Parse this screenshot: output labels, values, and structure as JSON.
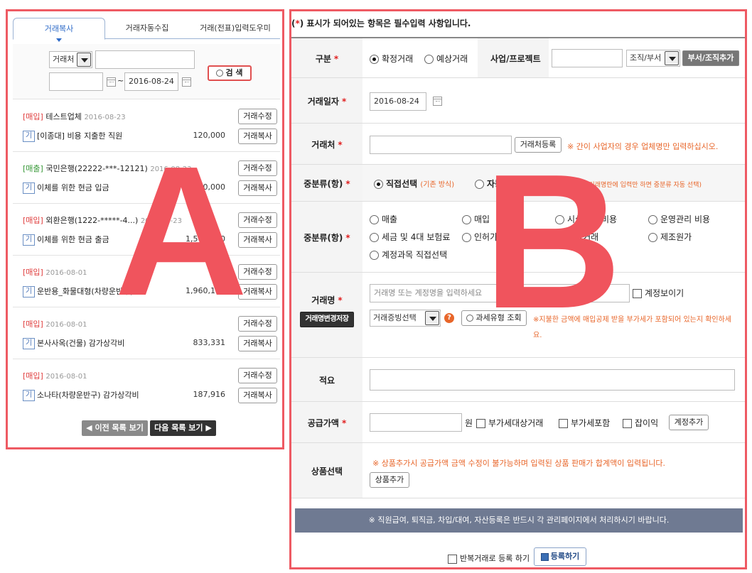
{
  "tabs": [
    {
      "label": "거래복사",
      "active": true
    },
    {
      "label": "거래자동수집",
      "active": false
    },
    {
      "label": "거래(전표)입력도우미",
      "active": false
    }
  ],
  "search": {
    "field_select": "거래처",
    "keyword": "",
    "date_from": "",
    "date_to": "2016-08-24",
    "date_sep": "~",
    "button": "검 색"
  },
  "list": {
    "items": [
      {
        "tag": "[매입]",
        "tag_type": "buy",
        "name": "테스트업체",
        "date": "2016-08-23",
        "ga": "기",
        "desc": "[이종대] 비용 지출한 직원",
        "amount": "120,000"
      },
      {
        "tag": "[매출]",
        "tag_type": "sell",
        "name": "국민은행(22222-***-12121)",
        "date": "2016-08-23",
        "ga": "기",
        "desc": "이체를 위한 현금 입금",
        "amount": "1,500,000"
      },
      {
        "tag": "[매입]",
        "tag_type": "buy",
        "name": "외환은행(1222-*****-4...)",
        "date": "2016-08-23",
        "ga": "기",
        "desc": "이체를 위한 현금 출금",
        "amount": "1,500,000"
      },
      {
        "tag": "[매입]",
        "tag_type": "buy",
        "name": "",
        "date": "2016-08-01",
        "ga": "기",
        "desc": "운반용_화물대형(차량운반구)…",
        "amount": "1,960,159"
      },
      {
        "tag": "[매입]",
        "tag_type": "buy",
        "name": "",
        "date": "2016-08-01",
        "ga": "기",
        "desc": "본사사옥(건물) 감가상각비",
        "amount": "833,331"
      },
      {
        "tag": "[매입]",
        "tag_type": "buy",
        "name": "",
        "date": "2016-08-01",
        "ga": "기",
        "desc": "소나타(차량운반구) 감가상각비",
        "amount": "187,916"
      }
    ],
    "edit_label": "거래수정",
    "copy_label": "거래복사",
    "prev_label": "◀ 이전 목록 보기",
    "next_label": "다음 목록 보기 ▶"
  },
  "overlay": {
    "a": "A",
    "b": "B"
  },
  "form": {
    "notice_prefix": "(",
    "notice_star": "*",
    "notice_text": ") 표시가 되어있는 항목은 필수입력 사항입니다.",
    "required_mark": "*",
    "division": {
      "label": "구분",
      "options": [
        "확정거래",
        "예상거래"
      ],
      "selected": 0,
      "project_label": "사업/프로젝트",
      "project_value": "",
      "org_select": "조직/부서",
      "add_button": "부서/조직추가"
    },
    "trade_date": {
      "label": "거래일자",
      "value": "2016-08-24"
    },
    "partner": {
      "label": "거래처",
      "value": "",
      "register_button": "거래처등록",
      "note": "※ 간이 사업자의 경우 업체명만 입력하십시오."
    },
    "mid_category_mode": {
      "label": "중분류(항)",
      "direct_label": "직접선택",
      "direct_note": "(기존 방식)",
      "search_label": "자동검색",
      "search_note": "(거래처/계정명 상관없이 거래명란에 입력만 하면 중분류 자동 선택)"
    },
    "mid_category": {
      "label": "중분류(항)",
      "options": [
        "매출",
        "매입",
        "시설관리 비용",
        "운영관리 비용",
        "세금 및 4대 보험료",
        "인허가 및 수수료",
        "기타거래",
        "제조원가",
        "계정과목 직접선택"
      ]
    },
    "trade_name": {
      "label": "거래명",
      "placeholder": "거래명 또는 계정명을 입력하세요",
      "show_account": "계정보이기",
      "change_button": "거래명변경저장",
      "evidence_select": "거래증빙선택",
      "help": "?",
      "tax_button": "과세유형 조회",
      "note": "※지불한 금액에 매입공제 받을 부가세가 포함되어 있는지 확인하세요."
    },
    "memo": {
      "label": "적요",
      "value": ""
    },
    "supply": {
      "label": "공급가액",
      "value": "",
      "unit": "원",
      "vat_target": "부가세대상거래",
      "vat_include": "부가세포함",
      "misc_income": "잡이익",
      "add_account": "계정추가"
    },
    "goods": {
      "label": "상품선택",
      "note": "※ 상품추가시 공급가액 금액 수정이 불가능하며 입력된 상품 판매가 합계액이 입력됩니다.",
      "add_button": "상품추가"
    },
    "footer_notice": "※ 직원급여, 퇴직금, 차입/대여, 자산등록은 반드시 각 관리페이지에서 처리하시기 바랍니다.",
    "repeat_label": "반복거래로 등록 하기",
    "register_button": "등록하기"
  },
  "colors": {
    "accent_red": "#ee5a63",
    "tab_blue": "#2e6bc8",
    "orange": "#e8662a",
    "footer_bar": "#6f7a92"
  }
}
